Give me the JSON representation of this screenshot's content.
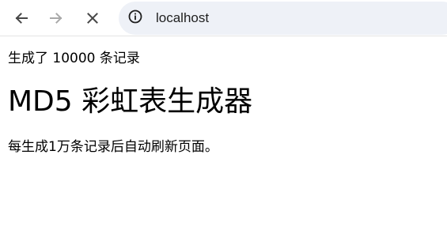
{
  "browser": {
    "url": "localhost",
    "icons": {
      "back": "back-arrow-icon",
      "forward": "forward-arrow-icon",
      "stop": "close-icon",
      "site_info": "info-icon"
    },
    "colors": {
      "toolbar_bg": "#ffffff",
      "address_bar_bg": "#eef1f7",
      "icon_active": "#474747",
      "icon_disabled": "#a9a9a9"
    }
  },
  "page": {
    "status_text": "生成了 10000 条记录",
    "title": "MD5 彩虹表生成器",
    "description": "每生成1万条记录后自动刷新页面。"
  }
}
